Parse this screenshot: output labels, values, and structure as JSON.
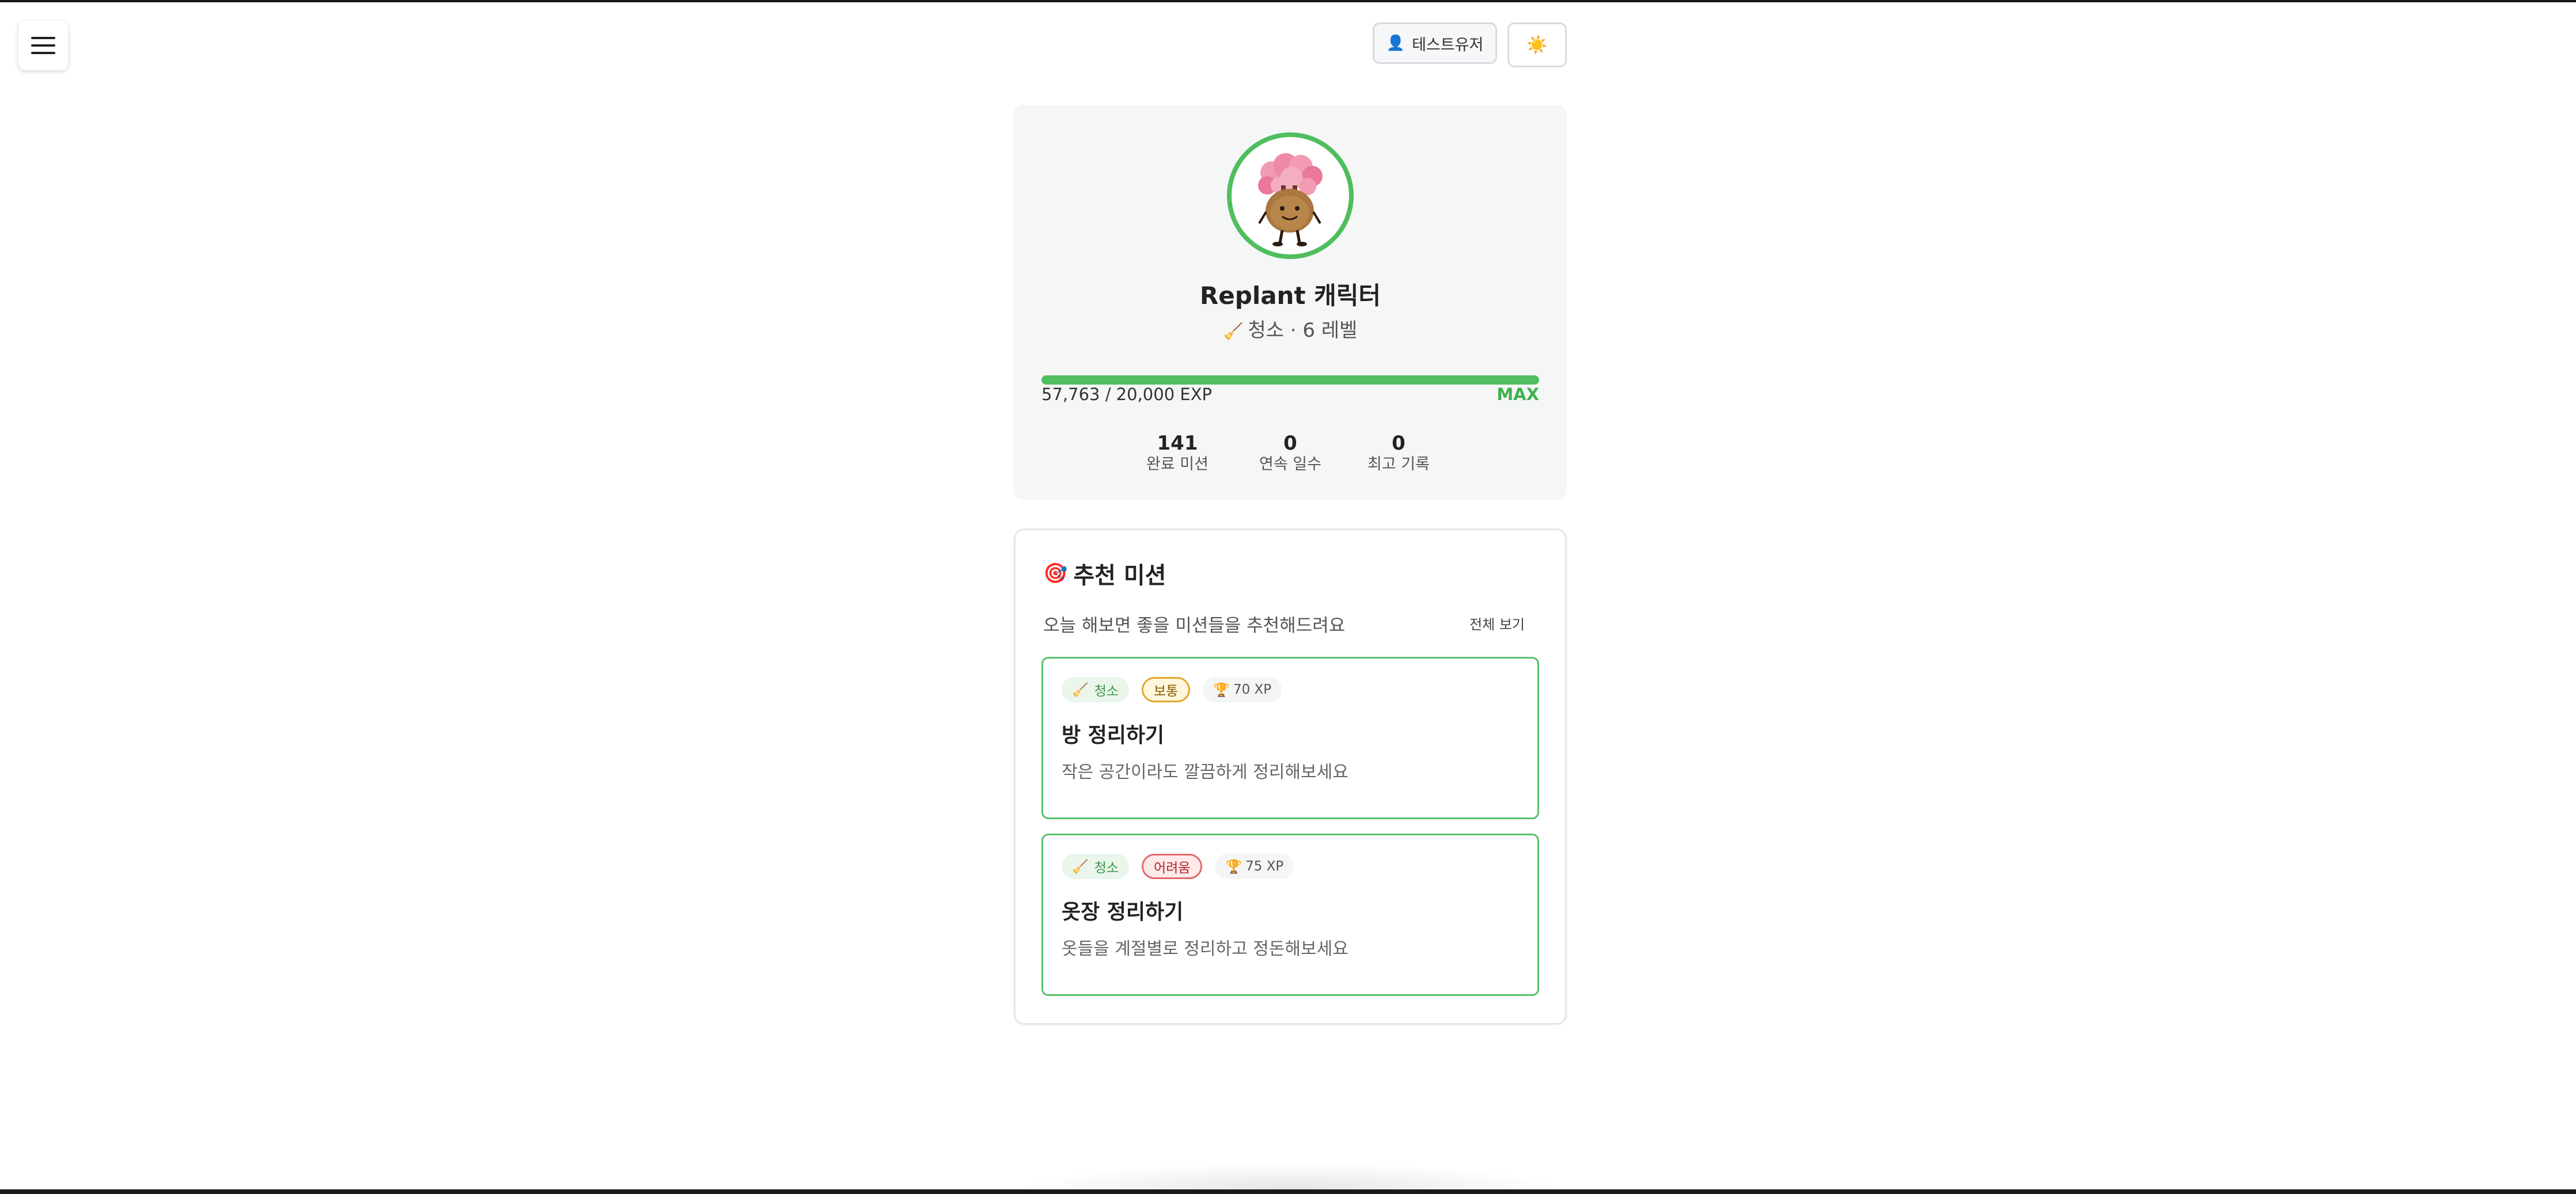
{
  "header": {
    "user_icon": "👤",
    "user_name": "테스트유저",
    "theme_icon": "☀️",
    "menu_icon": "hamburger-menu-icon"
  },
  "profile": {
    "name": "Replant 캐릭터",
    "category_icon": "🧹",
    "category_level": "청소 · 6 레벨",
    "exp_text": "57,763 / 20,000 EXP",
    "exp_progress": 1.0,
    "max_label": "MAX",
    "stats": [
      {
        "value": "141",
        "label": "완료 미션"
      },
      {
        "value": "0",
        "label": "연속 일수"
      },
      {
        "value": "0",
        "label": "최고 기록"
      }
    ]
  },
  "missions": {
    "title_icon": "🎯",
    "title": "추천 미션",
    "subtitle": "오늘 해보면 좋을 미션들을 추천해드려요",
    "view_all": "전체 보기",
    "items": [
      {
        "category_icon": "🧹",
        "category": "청소",
        "difficulty": "보통",
        "trophy_icon": "🏆",
        "xp": "70 XP",
        "title": "방 정리하기",
        "desc": "작은 공간이라도 깔끔하게 정리해보세요"
      },
      {
        "category_icon": "🧹",
        "category": "청소",
        "difficulty": "어려움",
        "trophy_icon": "🏆",
        "xp": "75 XP",
        "title": "옷장 정리하기",
        "desc": "옷들을 계절별로 정리하고 정돈해보세요"
      }
    ]
  },
  "colors": {
    "accent_green": "#4fbe5e",
    "normal_tag": "#e0a728",
    "hard_tag": "#e06a6a"
  }
}
